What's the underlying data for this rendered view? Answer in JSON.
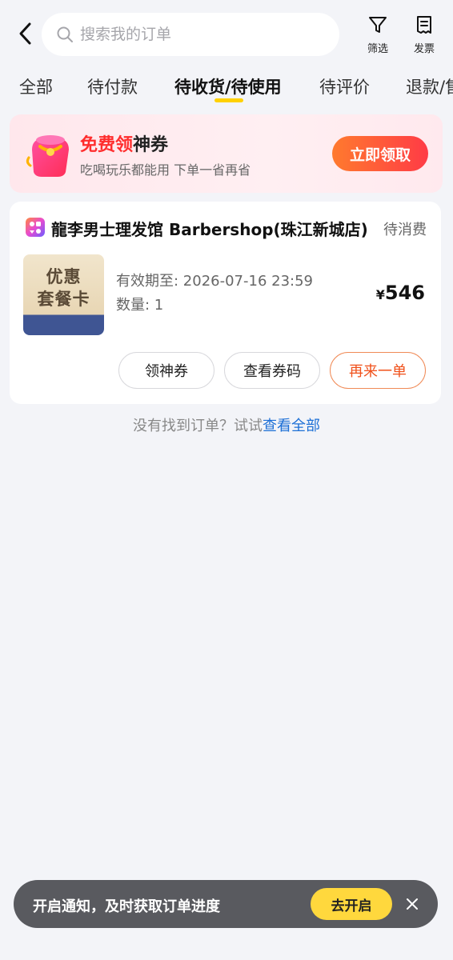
{
  "header": {
    "search_placeholder": "搜索我的订单",
    "filter_label": "筛选",
    "invoice_label": "发票"
  },
  "tabs": [
    {
      "label": "全部"
    },
    {
      "label": "待付款"
    },
    {
      "label": "待收货/待使用",
      "active": true
    },
    {
      "label": "待评价"
    },
    {
      "label": "退款/售后"
    }
  ],
  "banner": {
    "title_highlight": "免费领",
    "title_rest": "神券",
    "subtitle": "吃喝玩乐都能用 下单一省再省",
    "button_label": "立即领取"
  },
  "order": {
    "shop_name": "龍李男士理发馆 Barbershop(珠江新城店)",
    "status": "待消费",
    "thumb_line1": "优惠",
    "thumb_line2": "套餐卡",
    "validity": "有效期至: 2026-07-16 23:59",
    "quantity": "数量: 1",
    "price_symbol": "¥",
    "price_value": "546",
    "buttons": {
      "coupon": "领神券",
      "view_code": "查看券码",
      "reorder": "再来一单"
    }
  },
  "hint": {
    "text": "没有找到订单？试试",
    "link": "查看全部"
  },
  "notification": {
    "text": "开启通知，及时获取订单进度",
    "button_label": "去开启"
  },
  "colors": {
    "accent_yellow": "#ffd100",
    "promo_red": "#ff2d2d",
    "link_blue": "#1c6fd6",
    "reorder_orange": "#f0501a"
  }
}
